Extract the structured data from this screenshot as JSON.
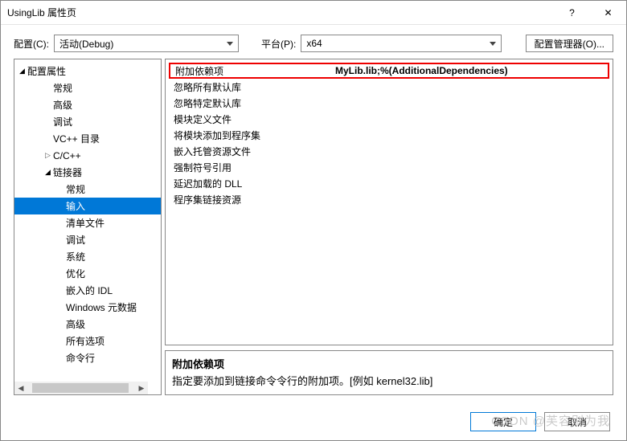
{
  "titlebar": {
    "title": "UsingLib 属性页",
    "help": "?",
    "close": "✕"
  },
  "configbar": {
    "configLabel": "配置(C):",
    "configValue": "活动(Debug)",
    "platformLabel": "平台(P):",
    "platformValue": "x64",
    "managerBtn": "配置管理器(O)..."
  },
  "tree": {
    "root": {
      "label": "配置属性"
    },
    "items": [
      {
        "label": "常规",
        "indent": 2
      },
      {
        "label": "高级",
        "indent": 2
      },
      {
        "label": "调试",
        "indent": 2
      },
      {
        "label": "VC++ 目录",
        "indent": 2
      },
      {
        "label": "C/C++",
        "indent": 2,
        "arrow": "▷"
      },
      {
        "label": "链接器",
        "indent": 2,
        "arrow": "◢"
      },
      {
        "label": "常规",
        "indent": 3
      },
      {
        "label": "输入",
        "indent": 3,
        "selected": true
      },
      {
        "label": "清单文件",
        "indent": 3
      },
      {
        "label": "调试",
        "indent": 3
      },
      {
        "label": "系统",
        "indent": 3
      },
      {
        "label": "优化",
        "indent": 3
      },
      {
        "label": "嵌入的 IDL",
        "indent": 3
      },
      {
        "label": "Windows 元数据",
        "indent": 3
      },
      {
        "label": "高级",
        "indent": 3
      },
      {
        "label": "所有选项",
        "indent": 3
      },
      {
        "label": "命令行",
        "indent": 3
      }
    ]
  },
  "grid": {
    "rows": [
      {
        "k": "附加依赖项",
        "v": "MyLib.lib;%(AdditionalDependencies)",
        "hl": true
      },
      {
        "k": "忽略所有默认库",
        "v": ""
      },
      {
        "k": "忽略特定默认库",
        "v": ""
      },
      {
        "k": "模块定义文件",
        "v": ""
      },
      {
        "k": "将模块添加到程序集",
        "v": ""
      },
      {
        "k": "嵌入托管资源文件",
        "v": ""
      },
      {
        "k": "强制符号引用",
        "v": ""
      },
      {
        "k": "延迟加载的 DLL",
        "v": ""
      },
      {
        "k": "程序集链接资源",
        "v": ""
      }
    ]
  },
  "desc": {
    "title": "附加依赖项",
    "text": "指定要添加到链接命令令行的附加项。[例如 kernel32.lib]"
  },
  "footer": {
    "ok": "确定",
    "cancel": "取消"
  },
  "watermark": "CSDN @芙容别为我"
}
